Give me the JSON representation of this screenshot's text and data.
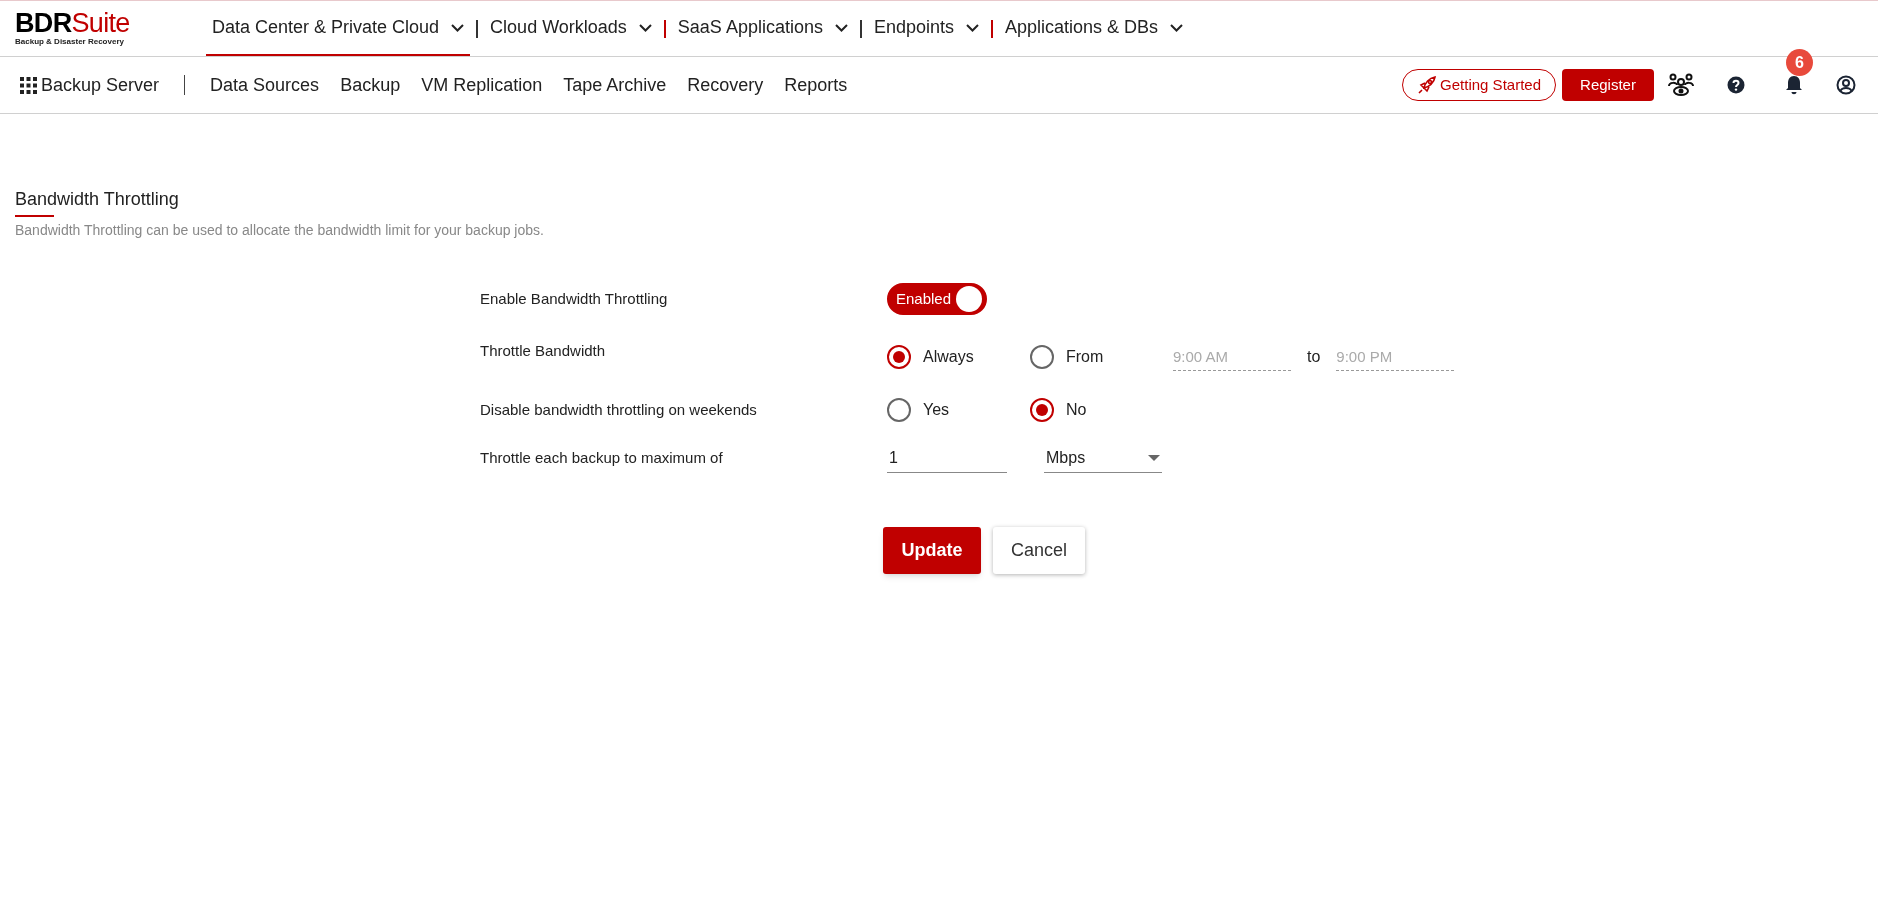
{
  "logo": {
    "brand": "BDR",
    "brand_accent": "Suite",
    "tagline": "Backup & Disaster Recovery"
  },
  "top_nav": [
    {
      "label": "Data Center & Private Cloud",
      "selected": true
    },
    {
      "label": "Cloud Workloads",
      "selected": false
    },
    {
      "label": "SaaS Applications",
      "selected": false
    },
    {
      "label": "Endpoints",
      "selected": false
    },
    {
      "label": "Applications & DBs",
      "selected": false
    }
  ],
  "sub_nav": {
    "product": "Backup Server",
    "items": [
      "Data Sources",
      "Backup",
      "VM Replication",
      "Tape Archive",
      "Recovery",
      "Reports"
    ]
  },
  "header_actions": {
    "getting_started": "Getting Started",
    "register": "Register",
    "notification_count": "6"
  },
  "page": {
    "title": "Bandwidth Throttling",
    "description": "Bandwidth Throttling can be used to allocate the bandwidth limit for your backup jobs."
  },
  "form": [
    {
      "kind": "toggle",
      "label": "Enable Bandwidth Throttling",
      "on": true,
      "on_text": "Enabled"
    },
    {
      "kind": "radio",
      "label": "Throttle Bandwidth",
      "options": [
        {
          "label": "Always",
          "selected": true
        },
        {
          "label": "From",
          "selected": false
        }
      ],
      "range": {
        "from": "9:00 AM",
        "separator": "to",
        "to": "9:00 PM",
        "disabled": true
      }
    },
    {
      "kind": "radio",
      "label": "Disable bandwidth throttling on weekends",
      "options": [
        {
          "label": "Yes",
          "selected": false
        },
        {
          "label": "No",
          "selected": true
        }
      ]
    },
    {
      "kind": "limit",
      "label": "Throttle each backup to maximum of",
      "value": "1",
      "unit": "Mbps"
    }
  ],
  "buttons": {
    "primary": "Update",
    "secondary": "Cancel"
  }
}
